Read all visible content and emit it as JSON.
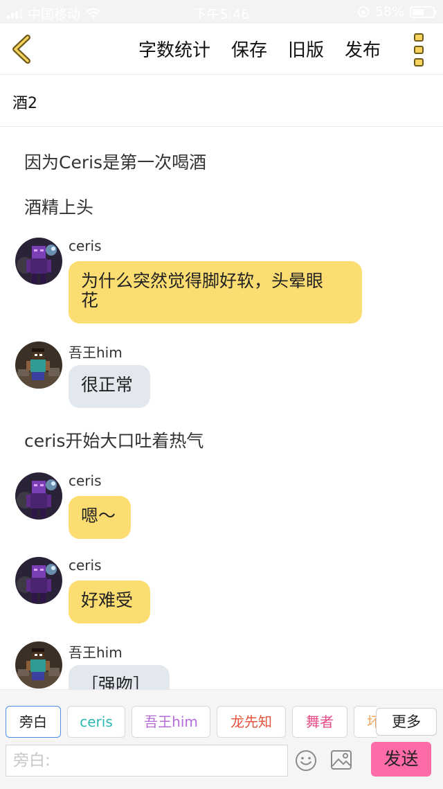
{
  "status_bar": {
    "carrier": "中国移动",
    "time": "下午5:46",
    "battery": "58%",
    "battery_level": 0.58
  },
  "header": {
    "actions": [
      "字数统计",
      "保存",
      "旧版",
      "发布"
    ]
  },
  "document": {
    "title": "酒2"
  },
  "content": {
    "narrations": [
      "因为Ceris是第一次喝酒",
      "酒精上头",
      "ceris开始大口吐着热气"
    ],
    "messages": [
      {
        "name": "ceris",
        "line1": "为什么突然觉得脚好软，头晕眼",
        "line2": "花"
      },
      {
        "name": "吾王him",
        "text": "很正常"
      },
      {
        "name": "ceris",
        "text": "嗯～"
      },
      {
        "name": "ceris",
        "text": "好难受"
      },
      {
        "name": "吾王him",
        "text": "［强吻］"
      }
    ]
  },
  "bottom_bar": {
    "roles": [
      {
        "label": "旁白",
        "color": "#222222"
      },
      {
        "label": "ceris",
        "color": "#2bb8b0"
      },
      {
        "label": "吾王him",
        "color": "#b46ad8"
      },
      {
        "label": "龙先知",
        "color": "#e5533d"
      },
      {
        "label": "舞者",
        "color": "#e64c86"
      },
      {
        "label": "坏",
        "color": "#f2a35c"
      }
    ],
    "more_label": "更多",
    "input_placeholder": "旁白:",
    "send_label": "发送"
  }
}
